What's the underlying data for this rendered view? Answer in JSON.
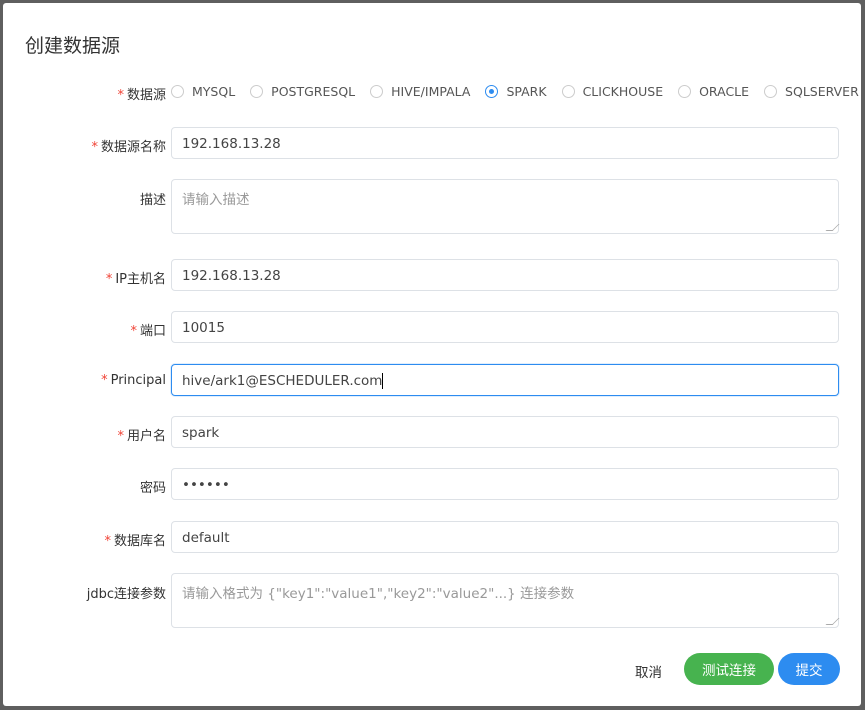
{
  "dialog": {
    "title": "创建数据源"
  },
  "form": {
    "type": {
      "label": "数据源",
      "options": [
        "MYSQL",
        "POSTGRESQL",
        "HIVE/IMPALA",
        "SPARK",
        "CLICKHOUSE",
        "ORACLE",
        "SQLSERVER"
      ],
      "selected": "SPARK"
    },
    "name": {
      "label": "数据源名称",
      "value": "192.168.13.28"
    },
    "desc": {
      "label": "描述",
      "placeholder": "请输入描述"
    },
    "host": {
      "label": "IP主机名",
      "value": "192.168.13.28"
    },
    "port": {
      "label": "端口",
      "value": "10015"
    },
    "principal": {
      "label": "Principal",
      "value": "hive/ark1@ESCHEDULER.com"
    },
    "user": {
      "label": "用户名",
      "value": "spark"
    },
    "password": {
      "label": "密码",
      "value": "••••••"
    },
    "database": {
      "label": "数据库名",
      "value": "default"
    },
    "jdbc": {
      "label": "jdbc连接参数",
      "placeholder": "请输入格式为 {\"key1\":\"value1\",\"key2\":\"value2\"...} 连接参数"
    },
    "required_mark": "*"
  },
  "buttons": {
    "cancel": "取消",
    "test": "测试连接",
    "submit": "提交"
  },
  "colors": {
    "primary": "#2d8cf0",
    "success": "#47b34f",
    "required": "#f04134"
  }
}
